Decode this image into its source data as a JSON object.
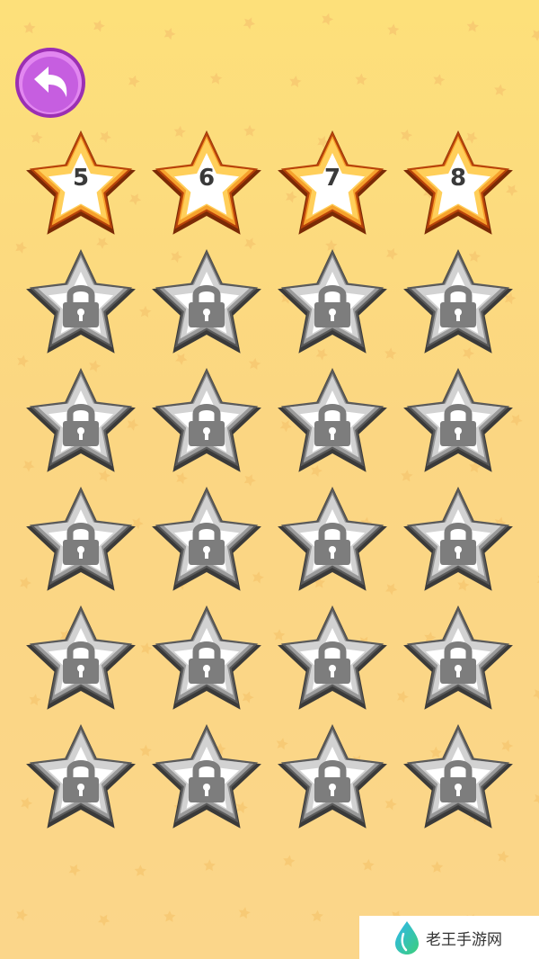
{
  "header": {
    "back_icon": "undo-arrow-icon"
  },
  "colors": {
    "background_top": "#fde07a",
    "background_bottom": "#fbd68a",
    "back_button": "#c65ee0",
    "unlocked_star_outline": "#b8430a",
    "unlocked_star_fill": "#f6a12c",
    "locked_star_fill": "#9a9a9a",
    "lock_icon": "#7d7d7d"
  },
  "levels": [
    {
      "number": "5",
      "state": "unlocked"
    },
    {
      "number": "6",
      "state": "unlocked"
    },
    {
      "number": "7",
      "state": "unlocked"
    },
    {
      "number": "8",
      "state": "unlocked"
    },
    {
      "state": "locked",
      "icon": "lock-icon"
    },
    {
      "state": "locked",
      "icon": "lock-icon"
    },
    {
      "state": "locked",
      "icon": "lock-icon"
    },
    {
      "state": "locked",
      "icon": "lock-icon"
    },
    {
      "state": "locked",
      "icon": "lock-icon"
    },
    {
      "state": "locked",
      "icon": "lock-icon"
    },
    {
      "state": "locked",
      "icon": "lock-icon"
    },
    {
      "state": "locked",
      "icon": "lock-icon"
    },
    {
      "state": "locked",
      "icon": "lock-icon"
    },
    {
      "state": "locked",
      "icon": "lock-icon"
    },
    {
      "state": "locked",
      "icon": "lock-icon"
    },
    {
      "state": "locked",
      "icon": "lock-icon"
    },
    {
      "state": "locked",
      "icon": "lock-icon"
    },
    {
      "state": "locked",
      "icon": "lock-icon"
    },
    {
      "state": "locked",
      "icon": "lock-icon"
    },
    {
      "state": "locked",
      "icon": "lock-icon"
    },
    {
      "state": "locked",
      "icon": "lock-icon"
    },
    {
      "state": "locked",
      "icon": "lock-icon"
    },
    {
      "state": "locked",
      "icon": "lock-icon"
    },
    {
      "state": "locked",
      "icon": "lock-icon"
    }
  ],
  "watermark": {
    "text": "老王手游网",
    "icon": "water-drop-logo-icon"
  }
}
